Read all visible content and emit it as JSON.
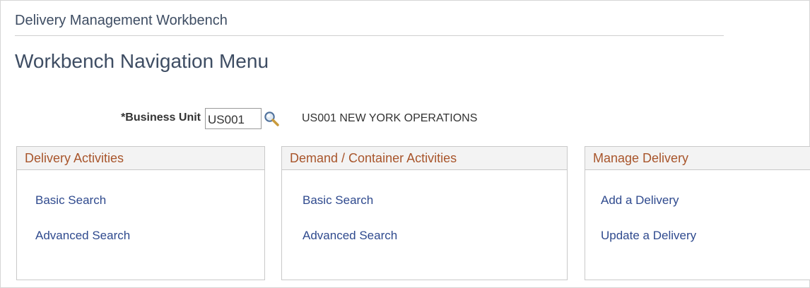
{
  "header": {
    "title": "Delivery Management Workbench"
  },
  "page": {
    "title": "Workbench Navigation Menu"
  },
  "business_unit": {
    "label": "*Business Unit",
    "value": "US001",
    "description": "US001 NEW YORK OPERATIONS",
    "lookup_icon": "search-icon"
  },
  "panels": [
    {
      "title": "Delivery Activities",
      "links": [
        {
          "label": "Basic Search"
        },
        {
          "label": "Advanced Search"
        }
      ]
    },
    {
      "title": "Demand / Container Activities",
      "links": [
        {
          "label": "Basic Search"
        },
        {
          "label": "Advanced Search"
        }
      ]
    },
    {
      "title": "Manage Delivery",
      "links": [
        {
          "label": "Add a Delivery"
        },
        {
          "label": "Update a Delivery"
        }
      ]
    }
  ],
  "colors": {
    "title": "#3e4d63",
    "panel_header_text": "#a8552b",
    "link": "#2f4a8e",
    "border": "#c9c9c9"
  }
}
